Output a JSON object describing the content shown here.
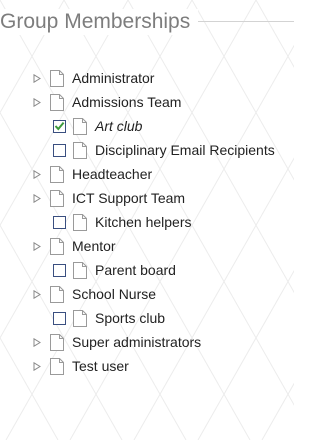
{
  "fieldset": {
    "legend": "Group Memberships"
  },
  "groups": [
    {
      "label": "Administrator",
      "kind": "expandable",
      "checked": false,
      "italic": false
    },
    {
      "label": "Admissions Team",
      "kind": "expandable",
      "checked": false,
      "italic": false
    },
    {
      "label": "Art club",
      "kind": "checkbox",
      "checked": true,
      "italic": true
    },
    {
      "label": "Disciplinary Email Recipients",
      "kind": "checkbox",
      "checked": false,
      "italic": false
    },
    {
      "label": "Headteacher",
      "kind": "expandable",
      "checked": false,
      "italic": false
    },
    {
      "label": "ICT Support Team",
      "kind": "expandable",
      "checked": false,
      "italic": false
    },
    {
      "label": "Kitchen helpers",
      "kind": "checkbox",
      "checked": false,
      "italic": false
    },
    {
      "label": "Mentor",
      "kind": "expandable",
      "checked": false,
      "italic": false
    },
    {
      "label": "Parent board",
      "kind": "checkbox",
      "checked": false,
      "italic": false
    },
    {
      "label": "School Nurse",
      "kind": "expandable",
      "checked": false,
      "italic": false
    },
    {
      "label": "Sports club",
      "kind": "checkbox",
      "checked": false,
      "italic": false
    },
    {
      "label": "Super administrators",
      "kind": "expandable",
      "checked": false,
      "italic": false
    },
    {
      "label": "Test user",
      "kind": "expandable",
      "checked": false,
      "italic": false
    }
  ],
  "icons": {
    "expander": "triangle-right-icon",
    "document": "document-icon",
    "check": "checkmark-icon"
  },
  "colors": {
    "check": "#3c9a3c",
    "checkbox_border": "#3a4f80",
    "pattern": "#ececec"
  }
}
